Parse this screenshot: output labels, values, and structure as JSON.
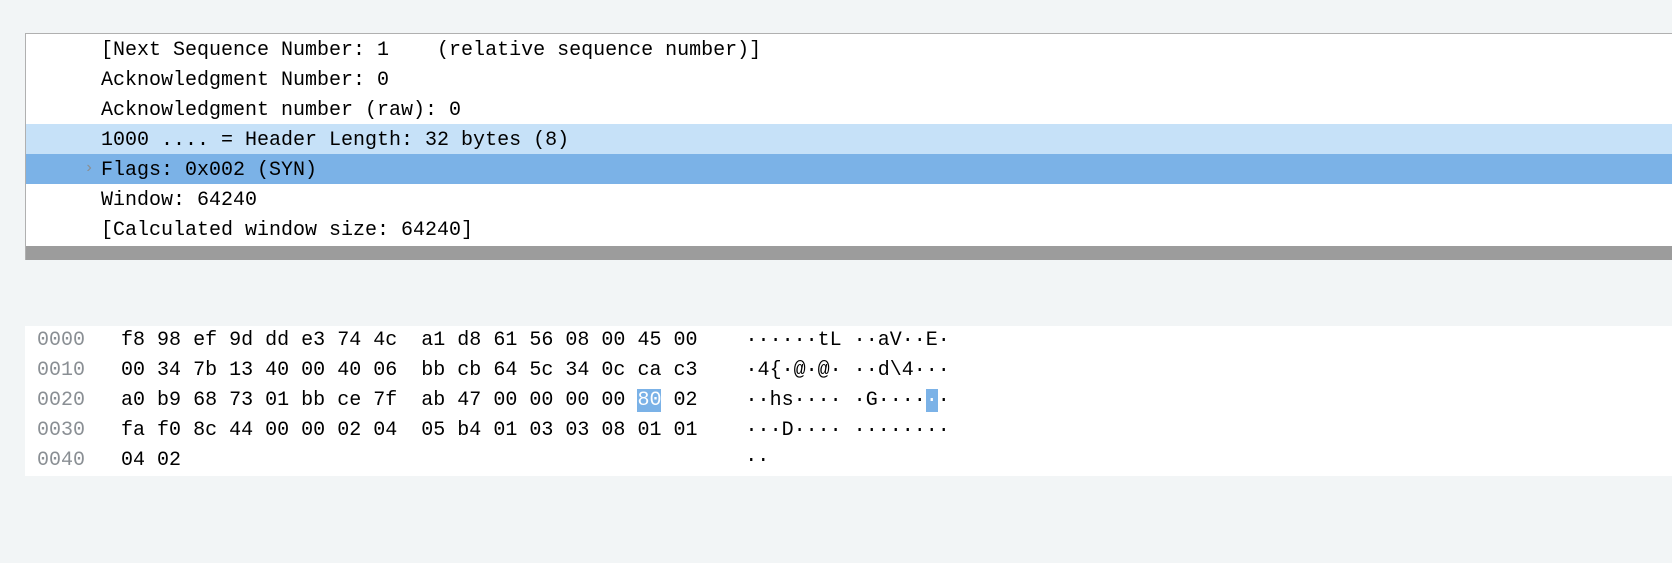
{
  "details": {
    "rows": [
      {
        "text": "[Next Sequence Number: 1    (relative sequence number)]",
        "highlight": "",
        "expandable": false
      },
      {
        "text": "Acknowledgment Number: 0",
        "highlight": "",
        "expandable": false
      },
      {
        "text": "Acknowledgment number (raw): 0",
        "highlight": "",
        "expandable": false
      },
      {
        "text": "1000 .... = Header Length: 32 bytes (8)",
        "highlight": "hl1",
        "expandable": false
      },
      {
        "text": "Flags: 0x002 (SYN)",
        "highlight": "sel",
        "expandable": true
      },
      {
        "text": "Window: 64240",
        "highlight": "",
        "expandable": false
      },
      {
        "text": "[Calculated window size: 64240]",
        "highlight": "",
        "expandable": false
      }
    ]
  },
  "hex": {
    "highlight_row": 2,
    "highlight_byte_index": 14,
    "highlight_ascii_index": 14,
    "rows": [
      {
        "offset": "0000",
        "bytes": [
          "f8",
          "98",
          "ef",
          "9d",
          "dd",
          "e3",
          "74",
          "4c",
          "a1",
          "d8",
          "61",
          "56",
          "08",
          "00",
          "45",
          "00"
        ],
        "ascii": [
          "·",
          "·",
          "·",
          "·",
          "·",
          "·",
          "t",
          "L",
          "·",
          "·",
          "a",
          "V",
          "·",
          "·",
          "E",
          "·"
        ]
      },
      {
        "offset": "0010",
        "bytes": [
          "00",
          "34",
          "7b",
          "13",
          "40",
          "00",
          "40",
          "06",
          "bb",
          "cb",
          "64",
          "5c",
          "34",
          "0c",
          "ca",
          "c3"
        ],
        "ascii": [
          "·",
          "4",
          "{",
          "·",
          "@",
          "·",
          "@",
          "·",
          "·",
          "·",
          "d",
          "\\",
          "4",
          "·",
          "·",
          "·"
        ]
      },
      {
        "offset": "0020",
        "bytes": [
          "a0",
          "b9",
          "68",
          "73",
          "01",
          "bb",
          "ce",
          "7f",
          "ab",
          "47",
          "00",
          "00",
          "00",
          "00",
          "80",
          "02"
        ],
        "ascii": [
          "·",
          "·",
          "h",
          "s",
          "·",
          "·",
          "·",
          "·",
          "·",
          "G",
          "·",
          "·",
          "·",
          "·",
          "·",
          "·"
        ]
      },
      {
        "offset": "0030",
        "bytes": [
          "fa",
          "f0",
          "8c",
          "44",
          "00",
          "00",
          "02",
          "04",
          "05",
          "b4",
          "01",
          "03",
          "03",
          "08",
          "01",
          "01"
        ],
        "ascii": [
          "·",
          "·",
          "·",
          "D",
          "·",
          "·",
          "·",
          "·",
          "·",
          "·",
          "·",
          "·",
          "·",
          "·",
          "·",
          "·"
        ]
      },
      {
        "offset": "0040",
        "bytes": [
          "04",
          "02"
        ],
        "ascii": [
          "·",
          "·"
        ]
      }
    ]
  }
}
